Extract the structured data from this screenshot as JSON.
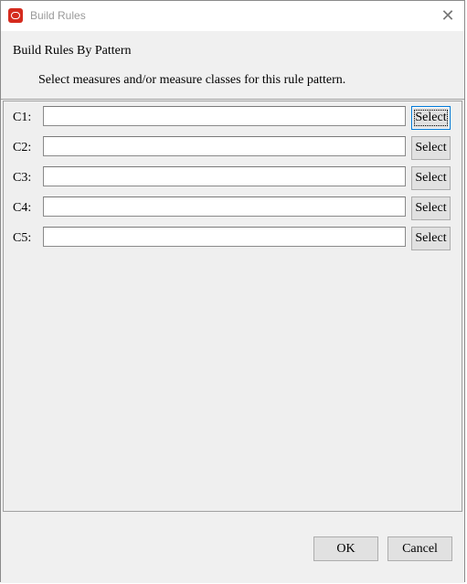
{
  "window": {
    "title": "Build Rules",
    "app_icon": "oracle-logo-icon",
    "close_glyph": "✕"
  },
  "header": {
    "title": "Build Rules By Pattern",
    "description": "Select measures and/or measure classes for this rule pattern."
  },
  "rows": [
    {
      "label": "C1:",
      "value": "",
      "button": "Select"
    },
    {
      "label": "C2:",
      "value": "",
      "button": "Select"
    },
    {
      "label": "C3:",
      "value": "",
      "button": "Select"
    },
    {
      "label": "C4:",
      "value": "",
      "button": "Select"
    },
    {
      "label": "C5:",
      "value": "",
      "button": "Select"
    }
  ],
  "footer": {
    "ok_label": "OK",
    "cancel_label": "Cancel"
  },
  "colors": {
    "dialog_bg": "#f0f0f0",
    "button_bg": "#e1e1e1",
    "focus_border": "#0078d7",
    "brand_red": "#d52b1e"
  }
}
